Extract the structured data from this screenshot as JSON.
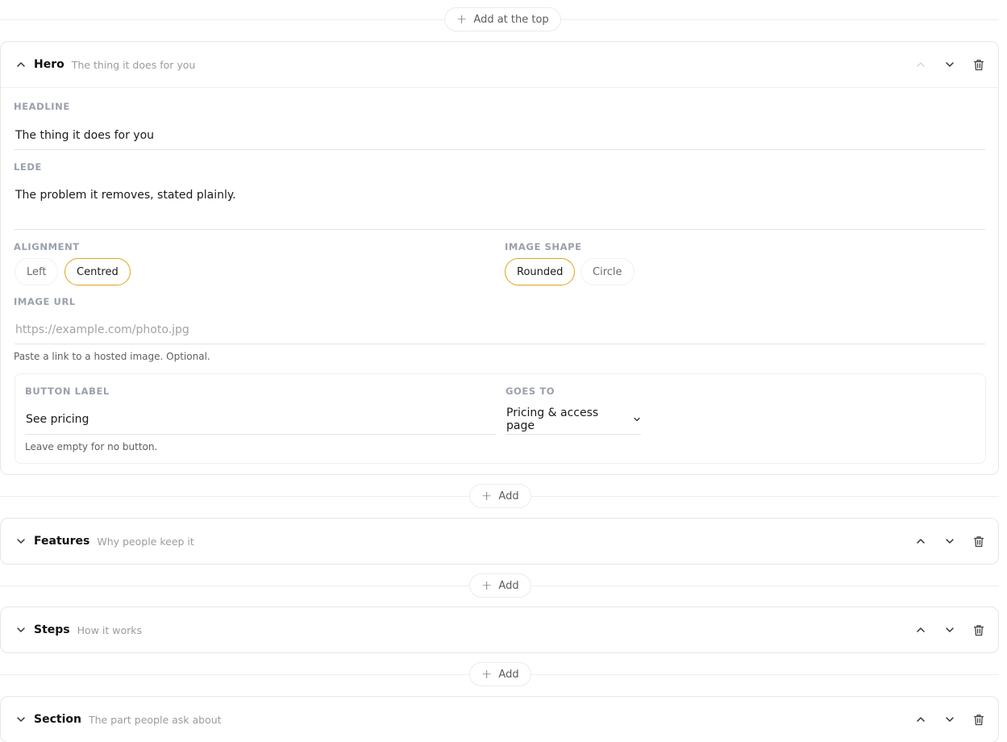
{
  "add_top": {
    "label": "Add at the top"
  },
  "add": {
    "label": "Add"
  },
  "hero": {
    "title": "Hero",
    "subtitle": "The thing it does for you",
    "headline_label": "Headline",
    "headline_value": "The thing it does for you",
    "lede_label": "Lede",
    "lede_value": "The problem it removes, stated plainly.",
    "alignment_label": "Alignment",
    "alignment_options": [
      "Left",
      "Centred"
    ],
    "alignment_selected": "Centred",
    "image_shape_label": "Image shape",
    "image_shape_options": [
      "Rounded",
      "Circle"
    ],
    "image_shape_selected": "Rounded",
    "image_url_label": "Image URL",
    "image_url_placeholder": "https://example.com/photo.jpg",
    "image_url_hint": "Paste a link to a hosted image. Optional.",
    "button_label_label": "Button label",
    "button_label_value": "See pricing",
    "button_label_hint": "Leave empty for no button.",
    "goes_to_label": "Goes to",
    "goes_to_value": "Pricing & access page"
  },
  "sections": [
    {
      "title": "Features",
      "subtitle": "Why people keep it"
    },
    {
      "title": "Steps",
      "subtitle": "How it works"
    },
    {
      "title": "Section",
      "subtitle": "The part people ask about"
    }
  ],
  "colors": {
    "accent": "#e3a21a",
    "border": "#e6e6e2",
    "label": "#9aa0ab"
  },
  "icons": [
    "plus-icon",
    "chevron-up-icon",
    "chevron-down-icon",
    "trash-icon"
  ]
}
